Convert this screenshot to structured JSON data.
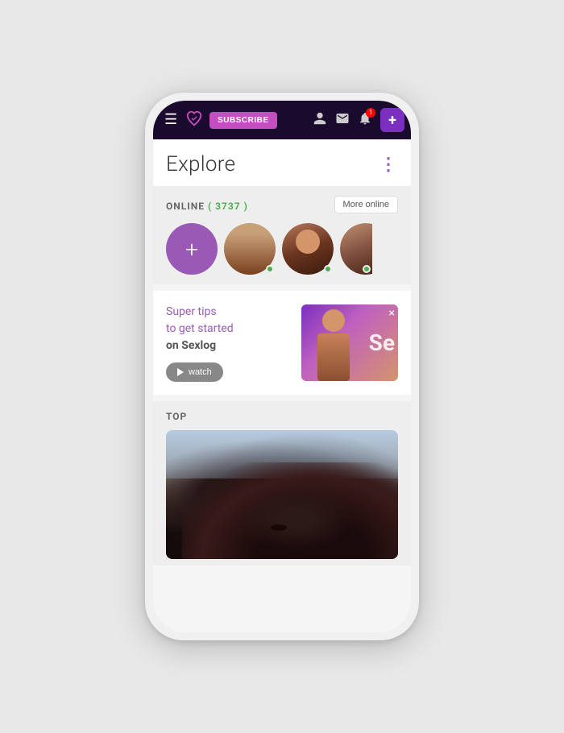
{
  "app": {
    "title": "Explore"
  },
  "nav": {
    "hamburger_icon": "☰",
    "subscribe_label": "SUBSCRIBE",
    "plus_label": "+",
    "bell_badge": "1"
  },
  "explore": {
    "title": "Explore",
    "menu_dots": "⋮"
  },
  "online": {
    "label": "ONLINE",
    "count": "3737",
    "count_display": "( 3737 )",
    "more_online_label": "More online",
    "add_label": "+"
  },
  "promo": {
    "line1": "Super tips",
    "line2": "to get started",
    "line3_prefix": "on ",
    "line3_brand": "Sexlog",
    "watch_label": "watch",
    "close": "×",
    "se_text": "Se"
  },
  "top": {
    "label": "TOP"
  }
}
